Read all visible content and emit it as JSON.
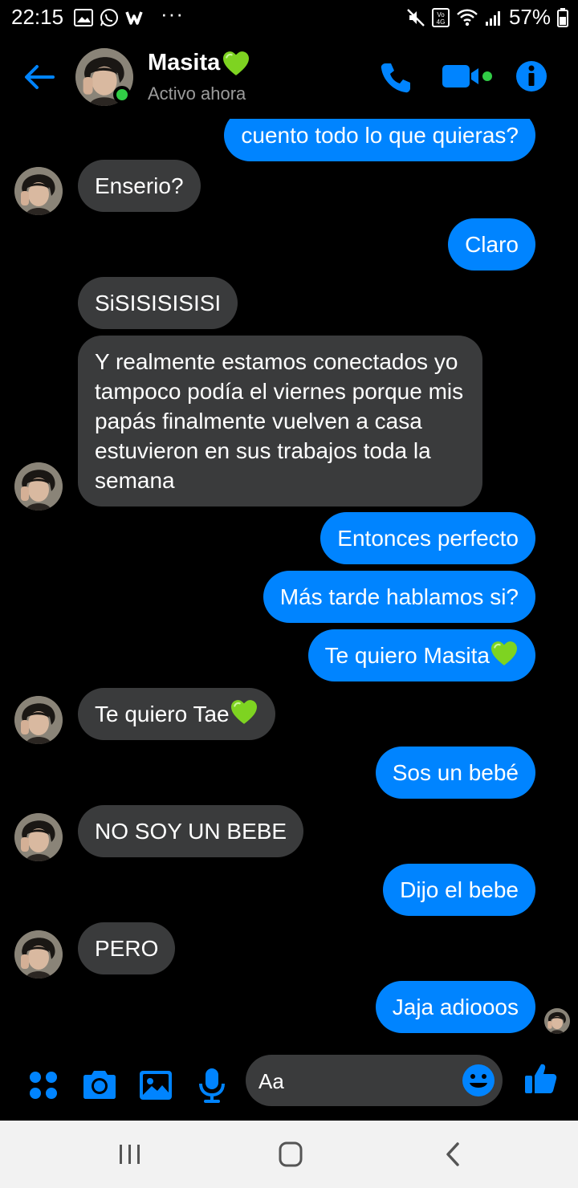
{
  "status_bar": {
    "time": "22:15",
    "dots": "···",
    "battery": "57%"
  },
  "header": {
    "name": "Masita",
    "status": "Activo ahora"
  },
  "messages": [
    {
      "dir": "out",
      "text": "cuento todo lo que quieras?"
    },
    {
      "dir": "in",
      "text": "Enserio?"
    },
    {
      "dir": "out",
      "text": "Claro"
    },
    {
      "dir": "in",
      "text": "SiSISISISISI"
    },
    {
      "dir": "in",
      "text": "Y realmente estamos conectados yo tampoco podía el viernes porque mis papás finalmente vuelven a casa estuvieron en sus trabajos toda la semana"
    },
    {
      "dir": "out",
      "text": "Entonces perfecto"
    },
    {
      "dir": "out",
      "text": "Más tarde hablamos si?"
    },
    {
      "dir": "out",
      "text": "Te quiero Masita"
    },
    {
      "dir": "in",
      "text": "Te quiero Tae"
    },
    {
      "dir": "out",
      "text": "Sos un bebé"
    },
    {
      "dir": "in",
      "text": "NO SOY UN BEBE"
    },
    {
      "dir": "out",
      "text": "Dijo el bebe"
    },
    {
      "dir": "in",
      "text": "PERO"
    },
    {
      "dir": "out",
      "text": "Jaja adiooos"
    }
  ],
  "composer": {
    "placeholder": "Aa"
  },
  "colors": {
    "accent": "#0084ff",
    "incoming_bubble": "#3a3b3c",
    "online": "#31cc46",
    "heart": "#7ed321"
  }
}
